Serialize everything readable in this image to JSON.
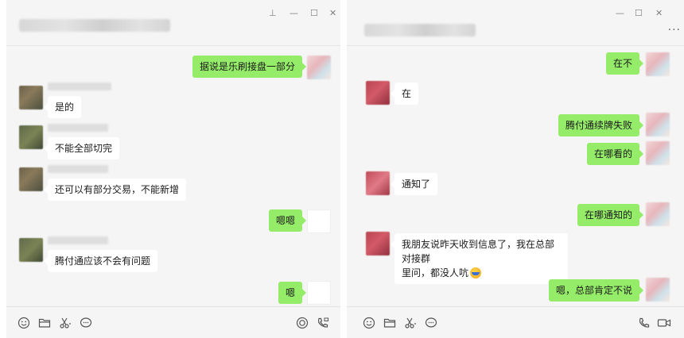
{
  "window_controls": {
    "pin": "⊥",
    "minimize": "—",
    "maximize": "☐",
    "close": "✕",
    "more": "···"
  },
  "left_chat": {
    "messages": [
      {
        "side": "out",
        "text": "据说是乐刷接盘一部分"
      },
      {
        "side": "in",
        "text": "是的"
      },
      {
        "side": "in",
        "text": "不能全部切完"
      },
      {
        "side": "in",
        "text": "还可以有部分交易，不能新增"
      },
      {
        "side": "out",
        "text": "嗯嗯"
      },
      {
        "side": "in",
        "text": "腾付通应该不会有问题"
      },
      {
        "side": "out",
        "text": "嗯"
      }
    ],
    "toolbar_icons": [
      "emoji-icon",
      "folder-icon",
      "scissors-icon",
      "chat-bubble-icon",
      "live-icon",
      "video-call-icon"
    ]
  },
  "right_chat": {
    "messages": [
      {
        "side": "out",
        "text": "在不"
      },
      {
        "side": "in",
        "text": "在"
      },
      {
        "side": "out",
        "text": "腾付通续牌失败"
      },
      {
        "side": "out",
        "text": "在哪看的"
      },
      {
        "side": "in",
        "text": "通知了"
      },
      {
        "side": "out",
        "text": "在哪通知的"
      },
      {
        "side": "in",
        "text_line1": "我朋友说昨天收到信息了，我在总部对接群",
        "text_line2": "里问，都没人吭"
      },
      {
        "side": "out",
        "text": "嗯，总部肯定不说"
      }
    ],
    "toolbar_icons": [
      "emoji-icon",
      "folder-icon",
      "scissors-icon",
      "chat-bubble-icon",
      "phone-icon",
      "video-icon"
    ]
  },
  "colors": {
    "outgoing_bubble": "#95ec69",
    "incoming_bubble": "#ffffff",
    "background": "#f5f5f5"
  }
}
